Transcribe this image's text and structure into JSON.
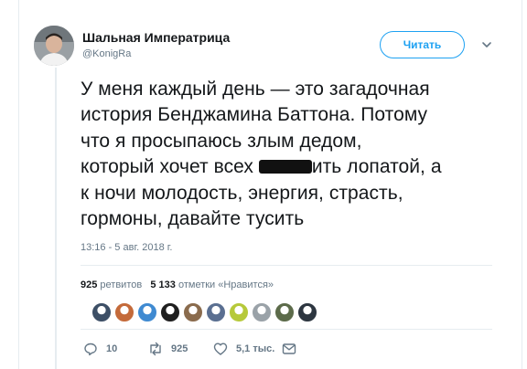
{
  "author": {
    "display_name": "Шальная Императрица",
    "handle": "@KonigRa"
  },
  "follow_button_label": "Читать",
  "tweet": {
    "lines": [
      "У меня каждый день — это загадочная",
      "история Бенджамина Баттона. Потому",
      "что я просыпаюсь злым дедом,",
      "который хочет всех",
      "ить лопатой, а",
      "к ночи молодость, энергия, страсть,",
      "гормоны, давайте тусить"
    ],
    "timestamp": "13:16 - 5 авг. 2018 г."
  },
  "stats": {
    "retweets_count": "925",
    "retweets_label": "ретвитов",
    "likes_count": "5 133",
    "likes_label": "отметки «Нравится»"
  },
  "likers": [
    {
      "color": "#3d4f66"
    },
    {
      "color": "#c46a3a"
    },
    {
      "color": "#3f8ad1"
    },
    {
      "color": "#1f1f1f"
    },
    {
      "color": "#8a6b4d"
    },
    {
      "color": "#5a6f91"
    },
    {
      "color": "#b6c93a"
    },
    {
      "color": "#9aa2a8"
    },
    {
      "color": "#5c6b4a"
    },
    {
      "color": "#2d3640"
    }
  ],
  "actions": {
    "reply_count": "10",
    "retweet_count": "925",
    "like_count": "5,1 тыс."
  },
  "colors": {
    "accent": "#1da1f2",
    "secondary_text": "#657786",
    "primary_text": "#14171a",
    "border": "#e6ecf0"
  },
  "icons": [
    "chevron-down-icon",
    "reply-icon",
    "retweet-icon",
    "heart-icon",
    "message-icon"
  ]
}
